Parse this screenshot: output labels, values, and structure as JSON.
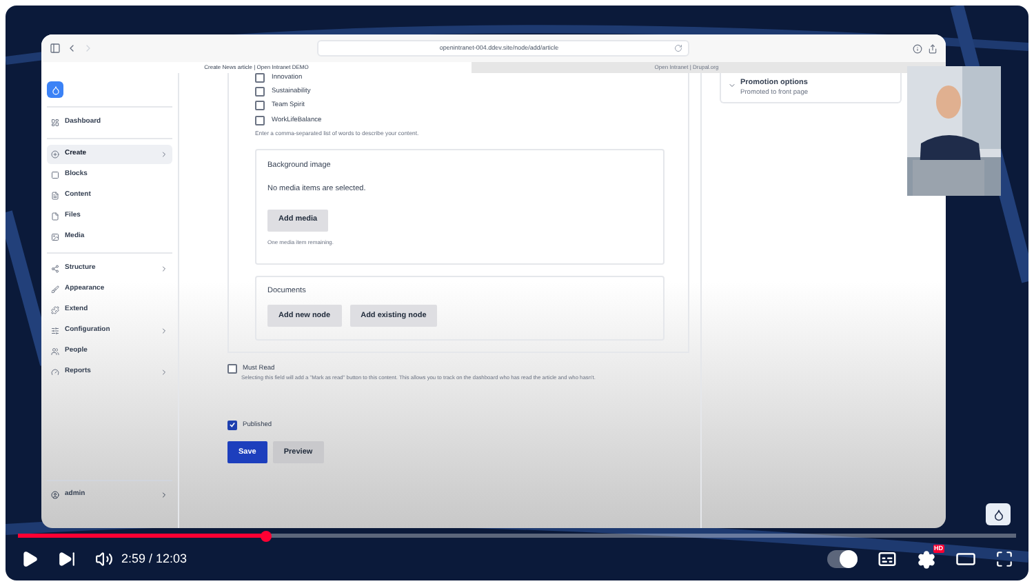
{
  "browser": {
    "url": "openintranet-004.ddev.site/node/add/article",
    "tabs": [
      {
        "title": "Create News article | Open Intranet DEMO",
        "selected": true
      },
      {
        "title": "Open Intranet | Drupal.org",
        "selected": false
      }
    ]
  },
  "sidebar": {
    "groups": [
      [
        {
          "label": "Dashboard",
          "has_children": false,
          "selected": false
        }
      ],
      [
        {
          "label": "Create",
          "has_children": true,
          "selected": true
        },
        {
          "label": "Blocks",
          "has_children": false,
          "selected": false
        },
        {
          "label": "Content",
          "has_children": false,
          "selected": false
        },
        {
          "label": "Files",
          "has_children": false,
          "selected": false
        },
        {
          "label": "Media",
          "has_children": false,
          "selected": false
        }
      ],
      [
        {
          "label": "Structure",
          "has_children": true,
          "selected": false
        },
        {
          "label": "Appearance",
          "has_children": false,
          "selected": false
        },
        {
          "label": "Extend",
          "has_children": false,
          "selected": false
        },
        {
          "label": "Configuration",
          "has_children": true,
          "selected": false
        },
        {
          "label": "People",
          "has_children": false,
          "selected": false
        },
        {
          "label": "Reports",
          "has_children": true,
          "selected": false
        }
      ]
    ],
    "user": "admin"
  },
  "tags": {
    "options": [
      {
        "label": "Innovation",
        "checked": false
      },
      {
        "label": "Sustainability",
        "checked": false
      },
      {
        "label": "Team Spirit",
        "checked": false
      },
      {
        "label": "WorkLifeBalance",
        "checked": false
      }
    ],
    "hint": "Enter a comma-separated list of words to describe your content."
  },
  "background_image": {
    "title": "Background image",
    "empty_text": "No media items are selected.",
    "button": "Add media",
    "hint": "One media item remaining."
  },
  "documents": {
    "title": "Documents",
    "buttons": [
      "Add new node",
      "Add existing node"
    ]
  },
  "must_read": {
    "label": "Must Read",
    "checked": false,
    "description": "Selecting this field will add a \"Mark as read\" button to this content. This allows you to track on the dashboard who has read the article and who hasn't."
  },
  "published": {
    "label": "Published",
    "checked": true
  },
  "actions": [
    {
      "label": "Save",
      "kind": "primary"
    },
    {
      "label": "Preview",
      "kind": "secondary"
    }
  ],
  "promotion": {
    "title": "Promotion options",
    "value": "Promoted to front page"
  },
  "player": {
    "autoplay_on": true,
    "level": 0.248,
    "time": "2:59 / 12:03",
    "quality_badge": "HD"
  }
}
